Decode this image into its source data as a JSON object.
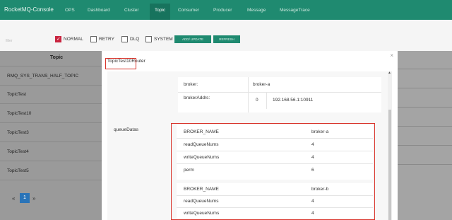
{
  "navbar": {
    "brand": "RocketMQ-Console",
    "items": [
      "OPS",
      "Dashboard",
      "Cluster",
      "Topic",
      "Consumer",
      "Producer",
      "Message",
      "MessageTrace"
    ],
    "active": "Topic"
  },
  "filter": {
    "placeholder": "filter",
    "checkboxes": [
      {
        "label": "NORMAL",
        "checked": true
      },
      {
        "label": "RETRY",
        "checked": false
      },
      {
        "label": "DLQ",
        "checked": false
      },
      {
        "label": "SYSTEM",
        "checked": false
      }
    ],
    "add_update_label": "ADD/ UPDATE",
    "refresh_label": "REFRESH"
  },
  "table": {
    "header": "Topic",
    "rows": [
      "RMQ_SYS_TRANS_HALF_TOPIC",
      "TopicTest",
      "TopicTest10",
      "TopicTest3",
      "TopicTest4",
      "TopicTest5"
    ]
  },
  "pager": {
    "prev": "«",
    "page": "1",
    "next": "»"
  },
  "modal": {
    "title": "TopicTest10Router",
    "close": "×",
    "broker": {
      "label": "broker:",
      "value": "broker-a"
    },
    "broker_addrs": {
      "label": "brokerAddrs:",
      "index": "0",
      "value": "192.168.56.1:10911"
    },
    "queue_datas_label": "queueDatas",
    "queue_datas": [
      {
        "BROKER_NAME": "broker-a",
        "readQueueNums": "4",
        "writeQueueNums": "4",
        "perm": "6"
      },
      {
        "BROKER_NAME": "broker-b",
        "readQueueNums": "4",
        "writeQueueNums": "4"
      }
    ],
    "keys": {
      "broker_name": "BROKER_NAME",
      "read": "readQueueNums",
      "write": "writeQueueNums",
      "perm": "perm"
    }
  },
  "colors": {
    "nav": "#1f8a70",
    "highlight": "#d9342b",
    "checked": "#c9243f",
    "page_active": "#2a74b8"
  }
}
